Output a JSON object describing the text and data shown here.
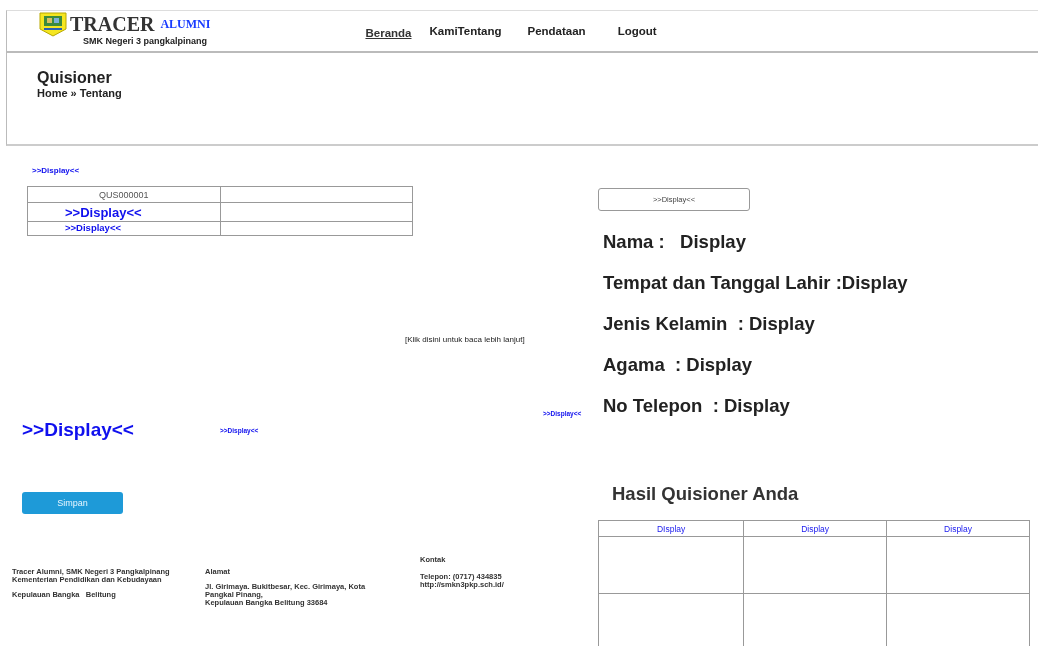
{
  "header": {
    "brand": "TRACER",
    "brand_suffix": "ALUMNI",
    "subtitle": "SMK Negeri 3 pangkalpinang",
    "nav": [
      {
        "label": "Beranda",
        "selected": true
      },
      {
        "label": "KamiTentang",
        "selected": false
      },
      {
        "label": "Pendataan",
        "selected": false
      },
      {
        "label": "Logout",
        "selected": false
      }
    ]
  },
  "page_title": "Quisioner",
  "breadcrumb": "Home » Tentang",
  "left": {
    "top_label": ">>Display<<",
    "table": {
      "rows": [
        {
          "cells": [
            "QUS000001",
            ""
          ],
          "kind": "id"
        },
        {
          "cells": [
            ">>Display<<",
            ""
          ],
          "kind": "large"
        },
        {
          "cells": [
            ">>Display<<",
            ""
          ],
          "kind": "small"
        }
      ]
    },
    "read_more": "[Klik disini untuk baca lebih lanjut]",
    "side_label": ">>Display<<",
    "big_label": ">>Display<<",
    "small_label": ">>Display<<",
    "save_button": "Simpan"
  },
  "right": {
    "select_button": ">>Display<<",
    "info": [
      "Nama :   Display",
      "Tempat dan Tanggal Lahir :Display",
      "Jenis Kelamin  : Display",
      "Agama  : Display",
      "No Telepon  : Display"
    ],
    "result_title": "Hasil Quisioner Anda",
    "result_table": {
      "columns": [
        "DIsplay",
        "Display",
        "Display"
      ]
    }
  },
  "footer": [
    {
      "lines": [
        "Tracer Alumni, SMK Negeri 3 Pangkalpinang\nKementerian Pendidikan dan Kebudayaan",
        "Kepulauan Bangka   Belitung"
      ]
    },
    {
      "heading": "Alamat",
      "lines": [
        "Jl. Girimaya. Bukitbesar, Kec. Girimaya, Kota\nPangkal Pinang,\nKepulauan Bangka Belitung 33684"
      ]
    },
    {
      "heading": "Kontak",
      "lines": [
        "Telepon: (0717) 434835\nhttp://smkn3pkp.sch.id/"
      ]
    }
  ]
}
